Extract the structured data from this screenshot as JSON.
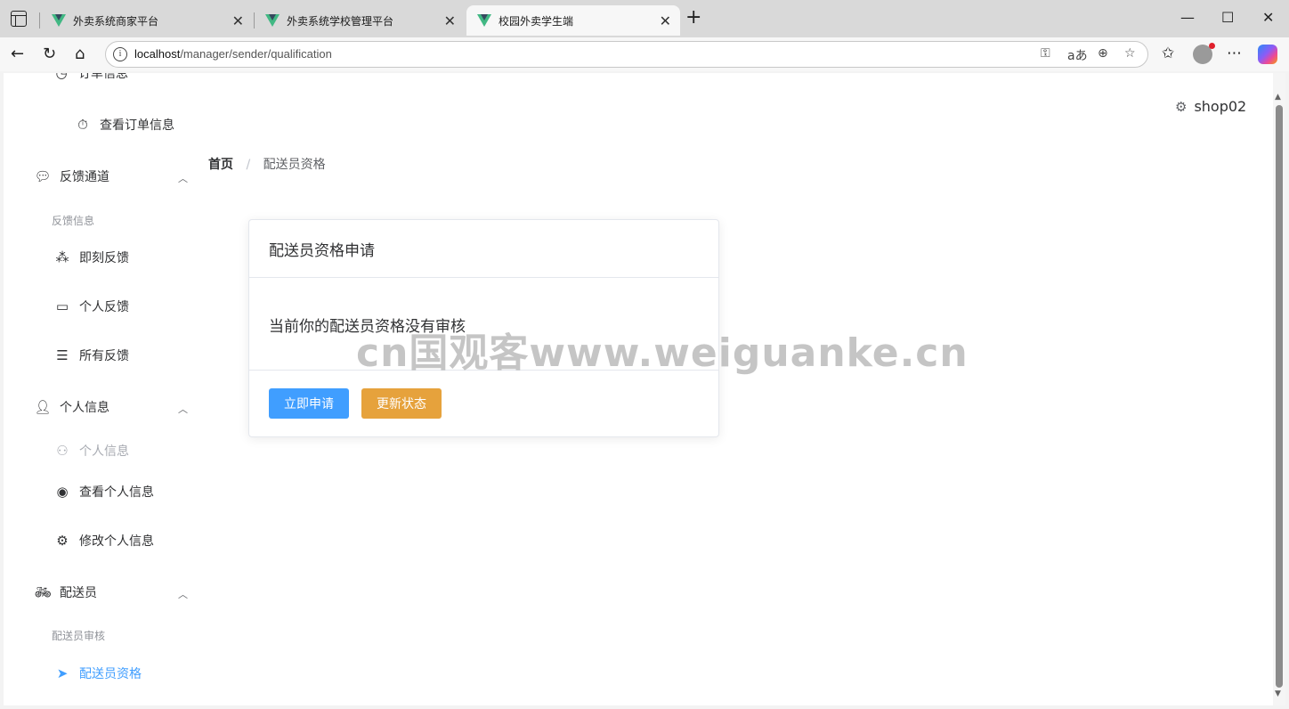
{
  "browser": {
    "tabs": [
      {
        "title": "外卖系统商家平台"
      },
      {
        "title": "外卖系统学校管理平台"
      },
      {
        "title": "校园外卖学生端"
      }
    ],
    "url_host": "localhost",
    "url_path": "/manager/sender/qualification",
    "new_tab": "+",
    "win_min": "—",
    "win_max": "☐",
    "win_close": "✕"
  },
  "sidebar": {
    "top_partial": "订单信息",
    "view_orders": "查看订单信息",
    "feedback_group": "反馈通道",
    "feedback_label": "反馈信息",
    "instant_feedback": "即刻反馈",
    "personal_feedback": "个人反馈",
    "all_feedback": "所有反馈",
    "personal_group": "个人信息",
    "personal_info": "个人信息",
    "view_personal": "查看个人信息",
    "edit_personal": "修改个人信息",
    "sender_group": "配送员",
    "sender_label": "配送员审核",
    "sender_qual": "配送员资格"
  },
  "header": {
    "username": "shop02"
  },
  "breadcrumb": {
    "home": "首页",
    "separator": "/",
    "current": "配送员资格"
  },
  "card": {
    "title": "配送员资格申请",
    "message": "当前你的配送员资格没有审核",
    "apply_button": "立即申请",
    "refresh_button": "更新状态"
  },
  "watermark": "cn国观客www.weiguanke.cn",
  "colors": {
    "primary": "#409eff",
    "warning": "#e6a23c",
    "active_menu": "#409eff"
  }
}
